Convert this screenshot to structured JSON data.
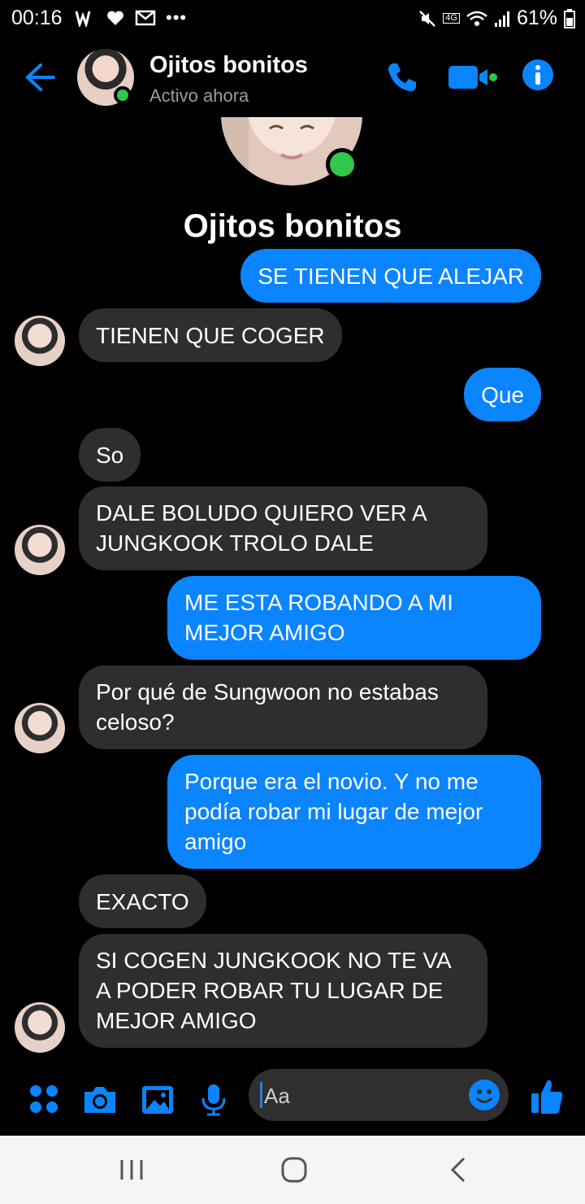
{
  "status_bar": {
    "time": "00:16",
    "battery": "61%",
    "network": "4G"
  },
  "header": {
    "contact_name": "Ojitos bonitos",
    "status": "Activo ahora"
  },
  "profile": {
    "name": "Ojitos bonitos"
  },
  "messages": [
    {
      "from": "me",
      "text": "SE TIENEN QUE ALEJAR"
    },
    {
      "from": "them",
      "text": "TIENEN QUE COGER"
    },
    {
      "from": "me",
      "text": "Que"
    },
    {
      "from": "them",
      "text": "So"
    },
    {
      "from": "them",
      "text": "DALE BOLUDO QUIERO VER A JUNGKOOK TROLO DALE"
    },
    {
      "from": "me",
      "text": "ME ESTA ROBANDO A MI MEJOR AMIGO"
    },
    {
      "from": "them",
      "text": "Por qué de Sungwoon no estabas celoso?"
    },
    {
      "from": "me",
      "text": "Porque era el novio. Y no me podía robar mi lugar de mejor amigo"
    },
    {
      "from": "them",
      "text": "EXACTO"
    },
    {
      "from": "them",
      "text": "SI COGEN JUNGKOOK NO TE VA A PODER ROBAR TU LUGAR DE MEJOR AMIGO"
    }
  ],
  "composer": {
    "placeholder": "Aa"
  },
  "colors": {
    "accent": "#0a84ff",
    "incoming_bubble": "#2e2e2e",
    "online": "#31c74a",
    "background": "#000000"
  },
  "icons": [
    "back-arrow-icon",
    "phone-icon",
    "video-camera-icon",
    "info-icon",
    "apps-grid-icon",
    "camera-icon",
    "image-icon",
    "microphone-icon",
    "emoji-icon",
    "thumbs-up-icon"
  ]
}
